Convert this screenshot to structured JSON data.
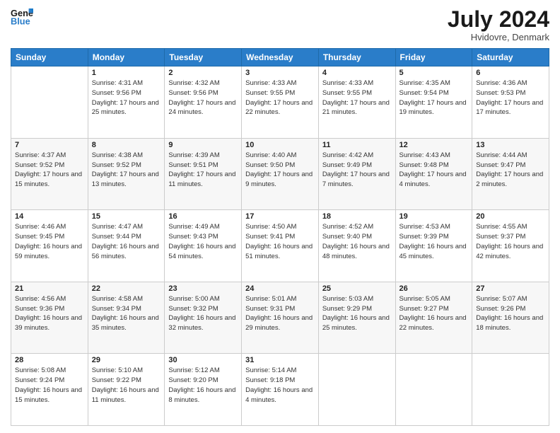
{
  "header": {
    "logo_line1": "General",
    "logo_line2": "Blue",
    "month_year": "July 2024",
    "location": "Hvidovre, Denmark"
  },
  "days_of_week": [
    "Sunday",
    "Monday",
    "Tuesday",
    "Wednesday",
    "Thursday",
    "Friday",
    "Saturday"
  ],
  "weeks": [
    [
      {
        "day": "",
        "sunrise": "",
        "sunset": "",
        "daylight": ""
      },
      {
        "day": "1",
        "sunrise": "Sunrise: 4:31 AM",
        "sunset": "Sunset: 9:56 PM",
        "daylight": "Daylight: 17 hours and 25 minutes."
      },
      {
        "day": "2",
        "sunrise": "Sunrise: 4:32 AM",
        "sunset": "Sunset: 9:56 PM",
        "daylight": "Daylight: 17 hours and 24 minutes."
      },
      {
        "day": "3",
        "sunrise": "Sunrise: 4:33 AM",
        "sunset": "Sunset: 9:55 PM",
        "daylight": "Daylight: 17 hours and 22 minutes."
      },
      {
        "day": "4",
        "sunrise": "Sunrise: 4:33 AM",
        "sunset": "Sunset: 9:55 PM",
        "daylight": "Daylight: 17 hours and 21 minutes."
      },
      {
        "day": "5",
        "sunrise": "Sunrise: 4:35 AM",
        "sunset": "Sunset: 9:54 PM",
        "daylight": "Daylight: 17 hours and 19 minutes."
      },
      {
        "day": "6",
        "sunrise": "Sunrise: 4:36 AM",
        "sunset": "Sunset: 9:53 PM",
        "daylight": "Daylight: 17 hours and 17 minutes."
      }
    ],
    [
      {
        "day": "7",
        "sunrise": "Sunrise: 4:37 AM",
        "sunset": "Sunset: 9:52 PM",
        "daylight": "Daylight: 17 hours and 15 minutes."
      },
      {
        "day": "8",
        "sunrise": "Sunrise: 4:38 AM",
        "sunset": "Sunset: 9:52 PM",
        "daylight": "Daylight: 17 hours and 13 minutes."
      },
      {
        "day": "9",
        "sunrise": "Sunrise: 4:39 AM",
        "sunset": "Sunset: 9:51 PM",
        "daylight": "Daylight: 17 hours and 11 minutes."
      },
      {
        "day": "10",
        "sunrise": "Sunrise: 4:40 AM",
        "sunset": "Sunset: 9:50 PM",
        "daylight": "Daylight: 17 hours and 9 minutes."
      },
      {
        "day": "11",
        "sunrise": "Sunrise: 4:42 AM",
        "sunset": "Sunset: 9:49 PM",
        "daylight": "Daylight: 17 hours and 7 minutes."
      },
      {
        "day": "12",
        "sunrise": "Sunrise: 4:43 AM",
        "sunset": "Sunset: 9:48 PM",
        "daylight": "Daylight: 17 hours and 4 minutes."
      },
      {
        "day": "13",
        "sunrise": "Sunrise: 4:44 AM",
        "sunset": "Sunset: 9:47 PM",
        "daylight": "Daylight: 17 hours and 2 minutes."
      }
    ],
    [
      {
        "day": "14",
        "sunrise": "Sunrise: 4:46 AM",
        "sunset": "Sunset: 9:45 PM",
        "daylight": "Daylight: 16 hours and 59 minutes."
      },
      {
        "day": "15",
        "sunrise": "Sunrise: 4:47 AM",
        "sunset": "Sunset: 9:44 PM",
        "daylight": "Daylight: 16 hours and 56 minutes."
      },
      {
        "day": "16",
        "sunrise": "Sunrise: 4:49 AM",
        "sunset": "Sunset: 9:43 PM",
        "daylight": "Daylight: 16 hours and 54 minutes."
      },
      {
        "day": "17",
        "sunrise": "Sunrise: 4:50 AM",
        "sunset": "Sunset: 9:41 PM",
        "daylight": "Daylight: 16 hours and 51 minutes."
      },
      {
        "day": "18",
        "sunrise": "Sunrise: 4:52 AM",
        "sunset": "Sunset: 9:40 PM",
        "daylight": "Daylight: 16 hours and 48 minutes."
      },
      {
        "day": "19",
        "sunrise": "Sunrise: 4:53 AM",
        "sunset": "Sunset: 9:39 PM",
        "daylight": "Daylight: 16 hours and 45 minutes."
      },
      {
        "day": "20",
        "sunrise": "Sunrise: 4:55 AM",
        "sunset": "Sunset: 9:37 PM",
        "daylight": "Daylight: 16 hours and 42 minutes."
      }
    ],
    [
      {
        "day": "21",
        "sunrise": "Sunrise: 4:56 AM",
        "sunset": "Sunset: 9:36 PM",
        "daylight": "Daylight: 16 hours and 39 minutes."
      },
      {
        "day": "22",
        "sunrise": "Sunrise: 4:58 AM",
        "sunset": "Sunset: 9:34 PM",
        "daylight": "Daylight: 16 hours and 35 minutes."
      },
      {
        "day": "23",
        "sunrise": "Sunrise: 5:00 AM",
        "sunset": "Sunset: 9:32 PM",
        "daylight": "Daylight: 16 hours and 32 minutes."
      },
      {
        "day": "24",
        "sunrise": "Sunrise: 5:01 AM",
        "sunset": "Sunset: 9:31 PM",
        "daylight": "Daylight: 16 hours and 29 minutes."
      },
      {
        "day": "25",
        "sunrise": "Sunrise: 5:03 AM",
        "sunset": "Sunset: 9:29 PM",
        "daylight": "Daylight: 16 hours and 25 minutes."
      },
      {
        "day": "26",
        "sunrise": "Sunrise: 5:05 AM",
        "sunset": "Sunset: 9:27 PM",
        "daylight": "Daylight: 16 hours and 22 minutes."
      },
      {
        "day": "27",
        "sunrise": "Sunrise: 5:07 AM",
        "sunset": "Sunset: 9:26 PM",
        "daylight": "Daylight: 16 hours and 18 minutes."
      }
    ],
    [
      {
        "day": "28",
        "sunrise": "Sunrise: 5:08 AM",
        "sunset": "Sunset: 9:24 PM",
        "daylight": "Daylight: 16 hours and 15 minutes."
      },
      {
        "day": "29",
        "sunrise": "Sunrise: 5:10 AM",
        "sunset": "Sunset: 9:22 PM",
        "daylight": "Daylight: 16 hours and 11 minutes."
      },
      {
        "day": "30",
        "sunrise": "Sunrise: 5:12 AM",
        "sunset": "Sunset: 9:20 PM",
        "daylight": "Daylight: 16 hours and 8 minutes."
      },
      {
        "day": "31",
        "sunrise": "Sunrise: 5:14 AM",
        "sunset": "Sunset: 9:18 PM",
        "daylight": "Daylight: 16 hours and 4 minutes."
      },
      {
        "day": "",
        "sunrise": "",
        "sunset": "",
        "daylight": ""
      },
      {
        "day": "",
        "sunrise": "",
        "sunset": "",
        "daylight": ""
      },
      {
        "day": "",
        "sunrise": "",
        "sunset": "",
        "daylight": ""
      }
    ]
  ]
}
